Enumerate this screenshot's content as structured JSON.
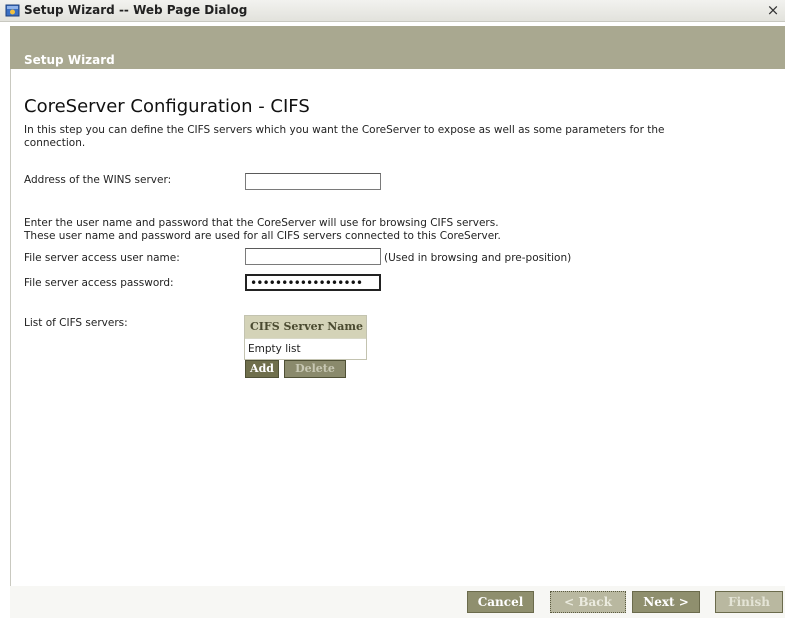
{
  "window": {
    "title": "Setup Wizard -- Web Page Dialog",
    "close": "×"
  },
  "header": {
    "title": "Setup Wizard"
  },
  "page": {
    "title": "CoreServer Configuration - CIFS",
    "description": "In this step you can define the CIFS servers which you want the CoreServer to expose as well as some parameters for the connection."
  },
  "form": {
    "wins_label": "Address of the WINS server:",
    "wins_value": "",
    "credentials_note_1": "Enter the user name and password that the CoreServer will use for browsing CIFS servers.",
    "credentials_note_2": "These user name and password are used for all CIFS servers connected to this CoreServer.",
    "username_label": "File server access user name:",
    "username_value": "",
    "username_hint": "(Used in browsing and pre-position)",
    "password_label": "File server access password:",
    "password_value": "••••••••••••••••••",
    "cifs_list_label": "List of CIFS servers:"
  },
  "cifs_table": {
    "column_header": "CIFS Server Name",
    "rows": [
      "Empty list"
    ],
    "add_label": "Add",
    "delete_label": "Delete"
  },
  "footer": {
    "cancel_label": "Cancel",
    "back_label": "< Back",
    "next_label": "Next >",
    "finish_label": "Finish"
  },
  "colors": {
    "header_band": "#a9a890",
    "button_enabled": "#8f8f6e",
    "button_disabled": "#b9b8a0",
    "table_header": "#d4d3b8"
  },
  "icons": {
    "title_icon": "ie-dialog-icon",
    "close_icon": "close-icon"
  }
}
